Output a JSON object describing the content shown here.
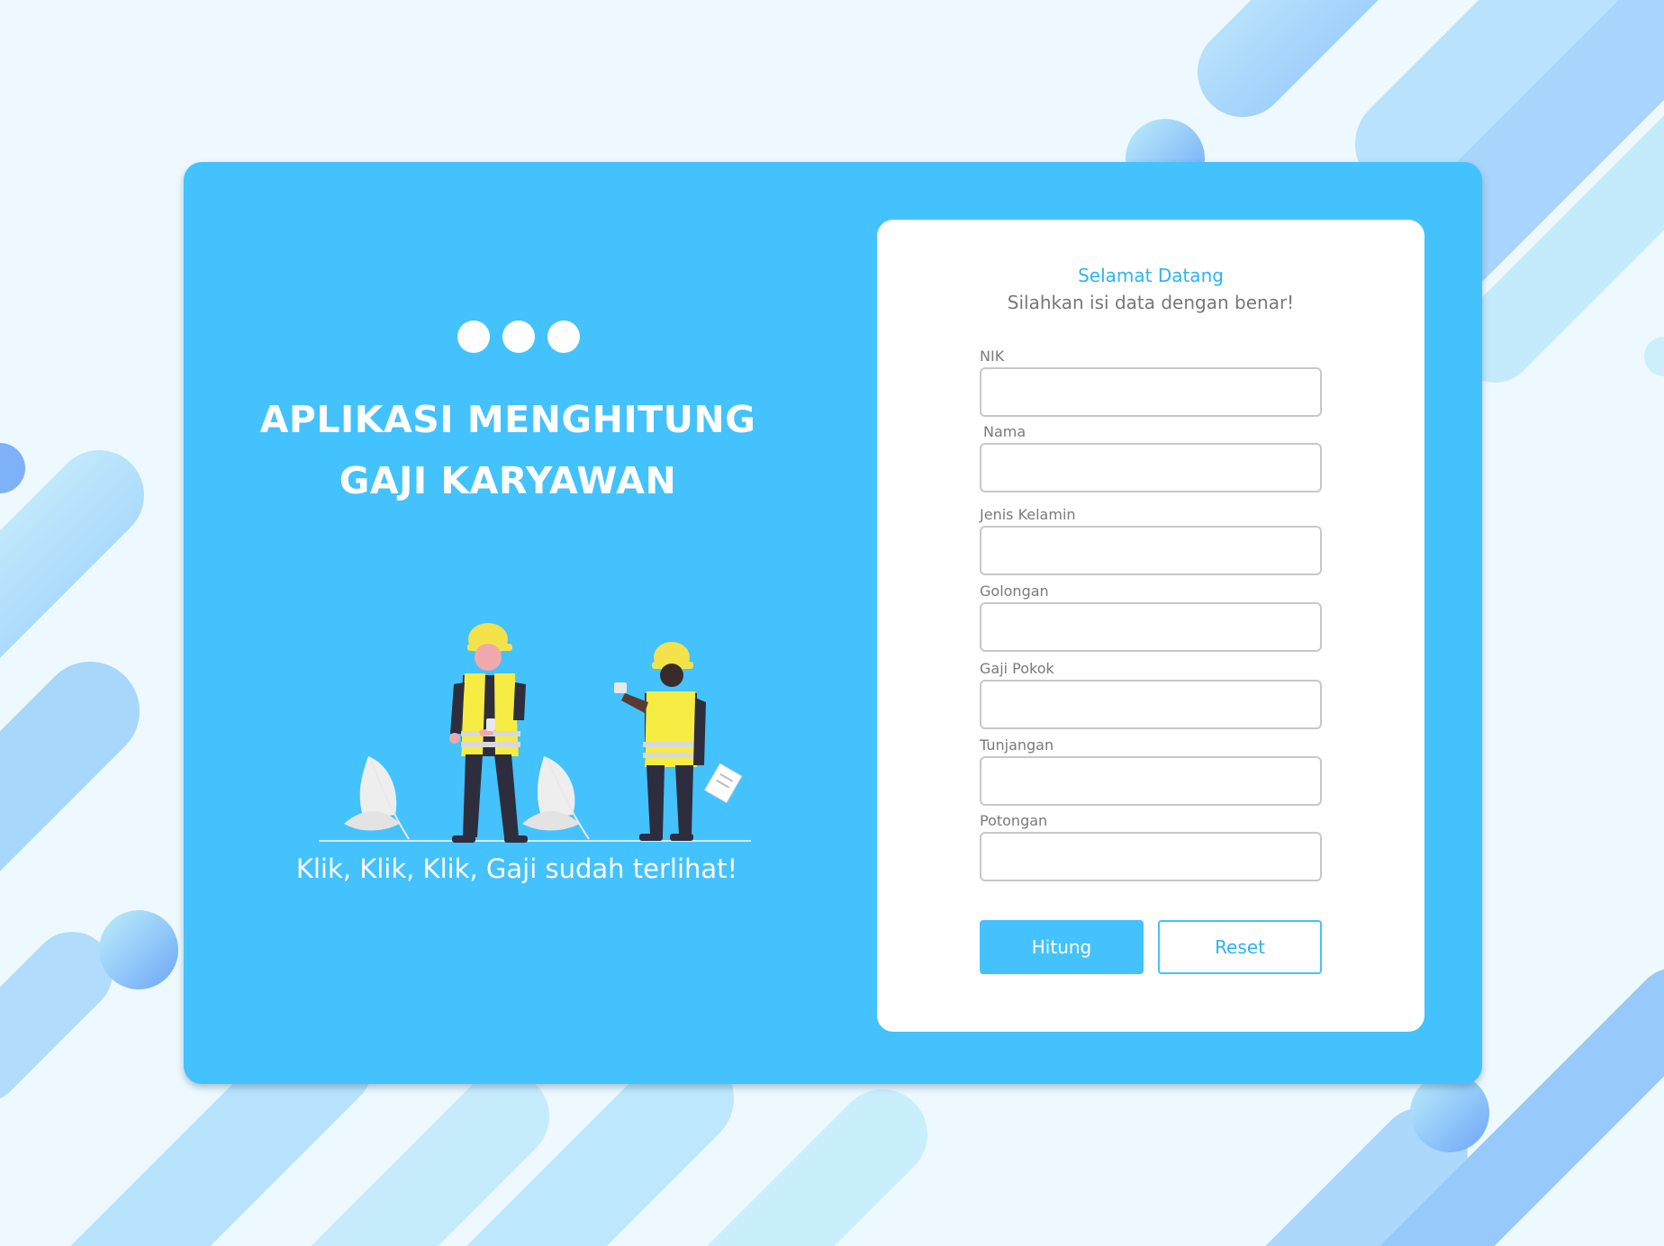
{
  "app": {
    "title_line1": "APLIKASI MENGHITUNG",
    "title_line2": "GAJI KARYAWAN",
    "tagline": "Klik, Klik, Klik, Gaji sudah terlihat!"
  },
  "form": {
    "welcome": "Selamat Datang",
    "subtitle": "Silahkan isi data dengan benar!",
    "fields": [
      {
        "label": "NIK",
        "value": ""
      },
      {
        "label": "Nama",
        "value": ""
      },
      {
        "label": "Jenis Kelamin",
        "value": ""
      },
      {
        "label": "Golongan",
        "value": ""
      },
      {
        "label": "Gaji Pokok",
        "value": ""
      },
      {
        "label": "Tunjangan",
        "value": ""
      },
      {
        "label": "Potongan",
        "value": ""
      }
    ],
    "buttons": {
      "primary": "Hitung",
      "secondary": "Reset"
    }
  },
  "colors": {
    "accent": "#43c2fd",
    "accent_text": "#2ab4f5",
    "background": "#eef9ff",
    "hardhat": "#f4e24a",
    "vest": "#f6ec43"
  }
}
